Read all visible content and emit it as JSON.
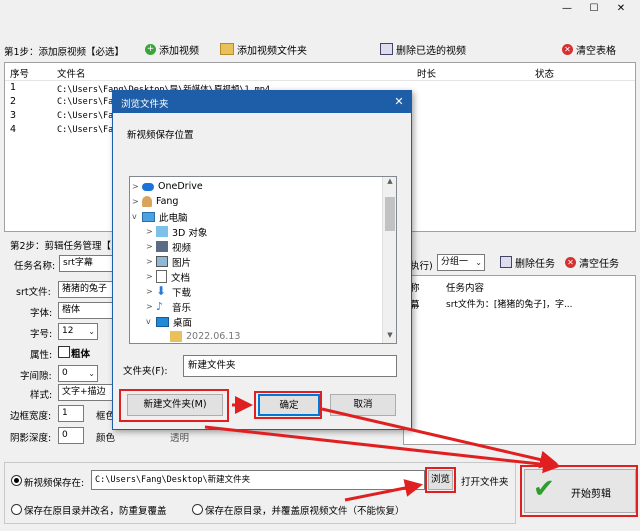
{
  "window": {
    "minimize_glyph": "—",
    "maximize_glyph": "☐",
    "close_glyph": "✕"
  },
  "toolbar": {
    "step1_label": "第1步：添加原视频【必选】",
    "add_video": "添加视频",
    "add_folder": "添加视频文件夹",
    "delete_selected": "删除已选的视频",
    "clear_table": "清空表格"
  },
  "table": {
    "headers": {
      "index": "序号",
      "filename": "文件名",
      "duration": "时长",
      "status": "状态"
    },
    "rows": [
      {
        "index": "1",
        "filename": "C:\\Users\\Fang\\Desktop\\导\\新媒体\\原视频\\1.mp4"
      },
      {
        "index": "2",
        "filename": "C:\\Users\\Fang\\Desktop\\"
      },
      {
        "index": "3",
        "filename": "C:\\Users\\Fang\\Desktop\\"
      },
      {
        "index": "4",
        "filename": "C:\\Users\\Fang\\Desktop\\"
      }
    ]
  },
  "step2": {
    "label": "第2步：剪辑任务管理【",
    "task_name_label": "任务名称:",
    "task_name_value": "srt字幕",
    "exec_label": "执行)",
    "group_value": "分组一",
    "delete_task": "删除任务",
    "clear_task": "清空任务",
    "task_col_name": "称",
    "task_col_content": "任务内容",
    "task_row_name": "幕",
    "task_row_content": "srt文件为：[猪猪的兔子]，字...",
    "srt_label": "srt文件:",
    "srt_value": "猪猪的兔子",
    "font_label": "字体:",
    "font_value": "楷体",
    "size_label": "字号:",
    "size_value": "12",
    "attr_label": "属性:",
    "bold_label": "粗体",
    "spacing_label": "字间隙:",
    "spacing_value": "0",
    "style_label": "样式:",
    "style_value": "文字+描边",
    "border_label": "边框宽度:",
    "border_value": "1",
    "border_color_label": "框色",
    "shadow_label": "阴影深度:",
    "shadow_value": "0",
    "color_label": "颜色",
    "partial_label": "透明"
  },
  "save": {
    "save_to_label": "新视频保存在:",
    "path_value": "C:\\Users\\Fang\\Desktop\\新建文件夹",
    "browse": "浏览",
    "open_folder": "打开文件夹",
    "option1": "保存在原目录并改名，防重复覆盖",
    "option2": "保存在原目录，并覆盖原视频文件（不能恢复）",
    "start_button": "开始剪辑"
  },
  "dialog": {
    "title": "浏览文件夹",
    "prompt": "新视频保存位置",
    "tree": [
      {
        "label": "OneDrive",
        "icon": "cloud-icon",
        "level": 1,
        "expander": ">"
      },
      {
        "label": "Fang",
        "icon": "user-icon",
        "level": 1,
        "expander": ">"
      },
      {
        "label": "此电脑",
        "icon": "computer-icon",
        "level": 1,
        "expander": "v"
      },
      {
        "label": "3D 对象",
        "icon": "cube-icon",
        "level": 2,
        "expander": ">"
      },
      {
        "label": "视频",
        "icon": "video-icon",
        "level": 2,
        "expander": ">"
      },
      {
        "label": "图片",
        "icon": "picture-icon",
        "level": 2,
        "expander": ">"
      },
      {
        "label": "文档",
        "icon": "document-icon",
        "level": 2,
        "expander": ">"
      },
      {
        "label": "下载",
        "icon": "download-icon",
        "level": 2,
        "expander": ">"
      },
      {
        "label": "音乐",
        "icon": "music-icon",
        "level": 2,
        "expander": ">"
      },
      {
        "label": "桌面",
        "icon": "desktop-icon",
        "level": 2,
        "expander": "v"
      },
      {
        "label": "2022.06.13",
        "icon": "folder-icon",
        "level": 3,
        "expander": ""
      }
    ],
    "folder_label": "文件夹(F):",
    "folder_value": "新建文件夹",
    "new_folder_button": "新建文件夹(M)",
    "ok_button": "确定",
    "cancel_button": "取消"
  },
  "colors": {
    "annotation_red": "#e02020",
    "dialog_title_bg": "#1e5ea8",
    "ok_border": "#0078d7"
  }
}
